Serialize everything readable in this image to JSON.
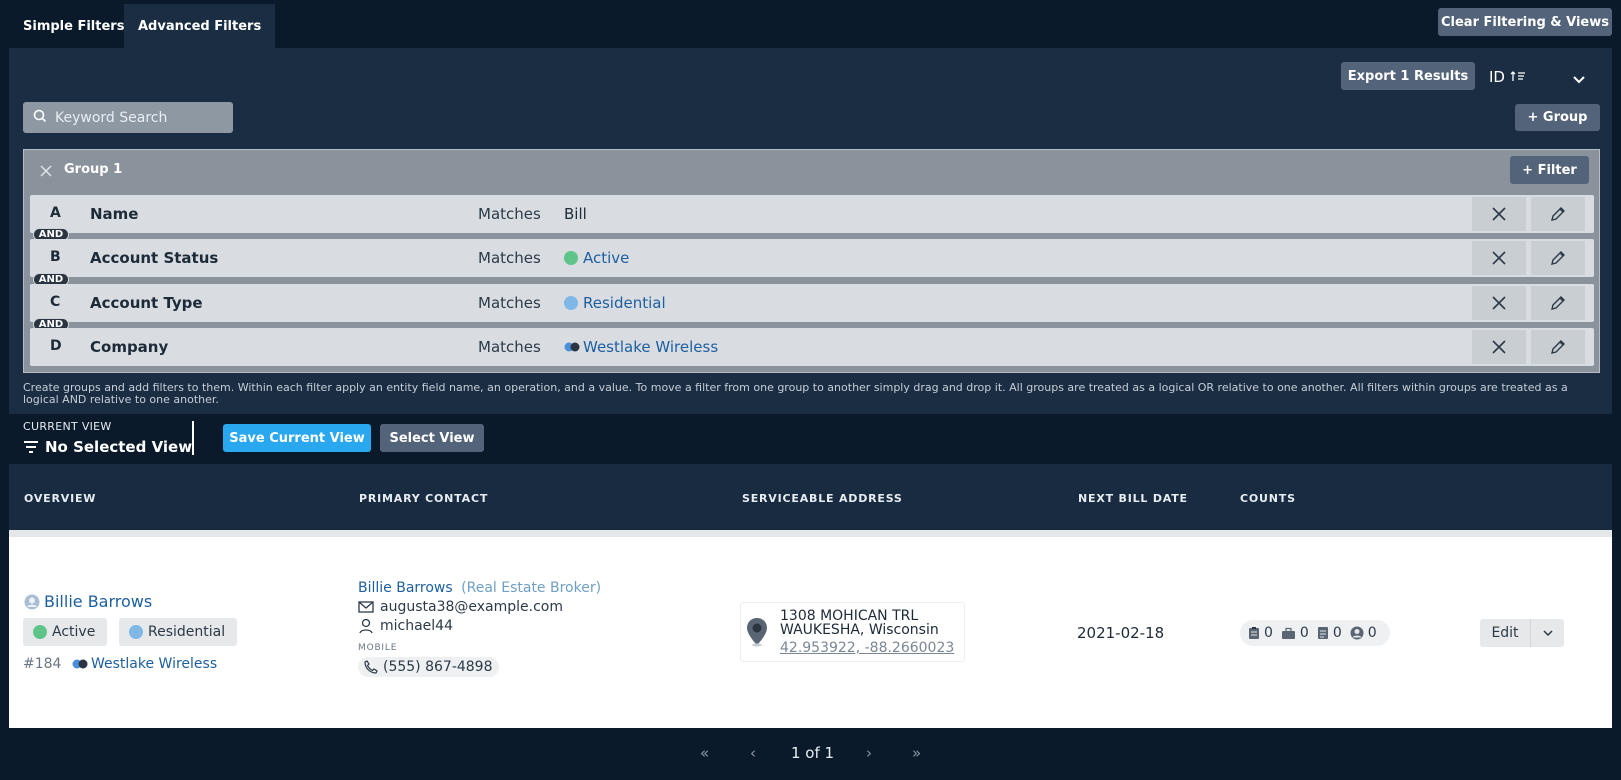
{
  "tabs": [
    {
      "label": "Simple Filters",
      "active": false
    },
    {
      "label": "Advanced Filters",
      "active": true
    }
  ],
  "clear_button": "Clear Filtering & Views",
  "export_button": "Export 1 Results",
  "sort": {
    "field": "ID",
    "icon": "sort-ascending-icon"
  },
  "search": {
    "placeholder": "Keyword Search",
    "value": ""
  },
  "add_group_button": "+ Group",
  "group": {
    "title": "Group 1",
    "add_filter_button": "+ Filter",
    "connector": "AND",
    "filters": [
      {
        "letter": "A",
        "field": "Name",
        "operator": "Matches",
        "value": "Bill",
        "dot": null
      },
      {
        "letter": "B",
        "field": "Account Status",
        "operator": "Matches",
        "value": "Active",
        "dot": "#5ec48a"
      },
      {
        "letter": "C",
        "field": "Account Type",
        "operator": "Matches",
        "value": "Residential",
        "dot": "#7fb8e6"
      },
      {
        "letter": "D",
        "field": "Company",
        "operator": "Matches",
        "value": "Westlake Wireless",
        "dot": "company"
      }
    ]
  },
  "help_text": "Create groups and add filters to them. Within each filter apply an entity field name, an operation, and a value. To move a filter from one group to another simply drag and drop it. All groups are treated as a logical OR relative to one another. All filters within groups are treated as a logical AND relative to one another.",
  "current_view": {
    "label": "CURRENT VIEW",
    "value": "No Selected View"
  },
  "save_view_button": "Save Current View",
  "select_view_button": "Select View",
  "columns": [
    "OVERVIEW",
    "PRIMARY CONTACT",
    "SERVICEABLE ADDRESS",
    "NEXT BILL DATE",
    "COUNTS"
  ],
  "row": {
    "name": "Billie Barrows",
    "status": "Active",
    "type": "Residential",
    "id": "#184",
    "company": "Westlake Wireless",
    "contact_name": "Billie Barrows",
    "contact_role": "(Real Estate Broker)",
    "email": "augusta38@example.com",
    "username": "michael44",
    "phone_label": "MOBILE",
    "phone": "(555) 867-4898",
    "address_line1": "1308 MOHICAN TRL",
    "address_line2": "WAUKESHA, Wisconsin",
    "coords": "42.953922, -88.2660023",
    "next_bill_date": "2021-02-18",
    "counts": [
      "0",
      "0",
      "0",
      "0"
    ],
    "edit_button": "Edit"
  },
  "pagination": {
    "first": "«",
    "prev": "‹",
    "page_text": "1 of 1",
    "next": "›",
    "last": "»"
  },
  "colors": {
    "accent": "#29a8f0",
    "active": "#5ec48a",
    "residential": "#7fb8e6",
    "link": "#1e5fa0"
  }
}
